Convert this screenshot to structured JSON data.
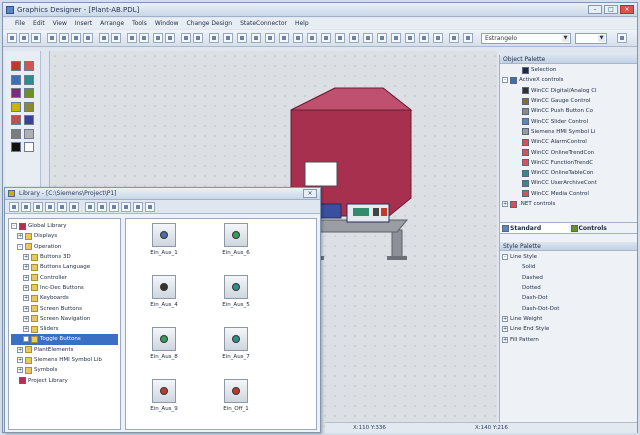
{
  "window": {
    "title": "Graphics Designer - [Plant-AB.PDL]"
  },
  "menu": [
    "File",
    "Edit",
    "View",
    "Insert",
    "Arrange",
    "Tools",
    "Window",
    "Change Design",
    "StateConnector",
    "Help"
  ],
  "toolbar": {
    "font_combo": "Estrangelo",
    "size_combo": ""
  },
  "palette": {
    "colors": [
      "#c0392b",
      "#d35454",
      "#3b6fb6",
      "#2f8d8d",
      "#7a2d7a",
      "#6b8f2a",
      "#c9b400",
      "#8a8a2d",
      "#c05050",
      "#3a3f9a",
      "#7b7b7b",
      "#b0b0b0",
      "#111111",
      "#ffffff"
    ]
  },
  "object_palette": {
    "header": "Object Palette",
    "items": [
      {
        "label": "Selection",
        "indent": 2,
        "expander": "",
        "icon": "pointer-icon",
        "color": "#1d2a40"
      },
      {
        "label": "ActiveX controls",
        "indent": 0,
        "expander": "-",
        "icon": "activex-icon",
        "color": "#3b6fb6"
      },
      {
        "label": "WinCC Digital/Analog Cl",
        "indent": 2,
        "expander": "",
        "icon": "clock-icon",
        "color": "#333333"
      },
      {
        "label": "WinCC Gauge Control",
        "indent": 2,
        "expander": "",
        "icon": "gauge-icon",
        "color": "#8a6d2d"
      },
      {
        "label": "WinCC Push Button Co",
        "indent": 2,
        "expander": "",
        "icon": "button-icon",
        "color": "#8a8a8a"
      },
      {
        "label": "WinCC Slider Control",
        "indent": 2,
        "expander": "",
        "icon": "slider-icon",
        "color": "#5a86c4"
      },
      {
        "label": "Siemens HMI Symbol Li",
        "indent": 2,
        "expander": "",
        "icon": "symbol-icon",
        "color": "#9a9a9a"
      },
      {
        "label": "WinCC AlarmControl",
        "indent": 2,
        "expander": "",
        "icon": "alarm-icon",
        "color": "#d35454"
      },
      {
        "label": "WinCC OnlineTrendCon",
        "indent": 2,
        "expander": "",
        "icon": "trend-icon",
        "color": "#d35454"
      },
      {
        "label": "WinCC FunctionTrendC",
        "indent": 2,
        "expander": "",
        "icon": "function-trend-icon",
        "color": "#d35454"
      },
      {
        "label": "WinCC OnlineTableCon",
        "indent": 2,
        "expander": "",
        "icon": "table-icon",
        "color": "#2f8d8d"
      },
      {
        "label": "WinCC UserArchiveCont",
        "indent": 2,
        "expander": "",
        "icon": "archive-icon",
        "color": "#2f8d8d"
      },
      {
        "label": "WinCC Media Control",
        "indent": 2,
        "expander": "",
        "icon": "media-icon",
        "color": "#d35454"
      },
      {
        "label": ".NET controls",
        "indent": 0,
        "expander": "+",
        "icon": "dotnet-icon",
        "color": "#d35454"
      }
    ],
    "tabs": [
      "Standard",
      "Controls"
    ]
  },
  "style_palette": {
    "header": "Style Palette",
    "items": [
      {
        "label": "Line Style",
        "indent": 0,
        "expander": "-"
      },
      {
        "label": "Solid",
        "indent": 2,
        "expander": ""
      },
      {
        "label": "Dashed",
        "indent": 2,
        "expander": ""
      },
      {
        "label": "Dotted",
        "indent": 2,
        "expander": ""
      },
      {
        "label": "Dash-Dot",
        "indent": 2,
        "expander": ""
      },
      {
        "label": "Dash-Dot-Dot",
        "indent": 2,
        "expander": ""
      },
      {
        "label": "Line Weight",
        "indent": 0,
        "expander": "+"
      },
      {
        "label": "Line End Style",
        "indent": 0,
        "expander": "+"
      },
      {
        "label": "Fill Pattern",
        "indent": 0,
        "expander": "+"
      }
    ]
  },
  "library": {
    "title": "Library - [C:\\Siemens\\Project\\P1]",
    "tree": [
      {
        "label": "Global Library",
        "indent": 0,
        "expander": "-",
        "icon": "globe-icon"
      },
      {
        "label": "Displays",
        "indent": 1,
        "expander": "+",
        "icon": "folder-icon"
      },
      {
        "label": "Operation",
        "indent": 1,
        "expander": "-",
        "icon": "folder-icon"
      },
      {
        "label": "Buttons 3D",
        "indent": 2,
        "expander": "+",
        "icon": "folder-icon"
      },
      {
        "label": "Buttons Language",
        "indent": 2,
        "expander": "+",
        "icon": "folder-icon"
      },
      {
        "label": "Controller",
        "indent": 2,
        "expander": "+",
        "icon": "folder-icon"
      },
      {
        "label": "Inc-Dec Buttons",
        "indent": 2,
        "expander": "+",
        "icon": "folder-icon"
      },
      {
        "label": "Keyboards",
        "indent": 2,
        "expander": "+",
        "icon": "folder-icon"
      },
      {
        "label": "Screen Buttons",
        "indent": 2,
        "expander": "+",
        "icon": "folder-icon"
      },
      {
        "label": "Screen Navigation",
        "indent": 2,
        "expander": "+",
        "icon": "folder-icon"
      },
      {
        "label": "Sliders",
        "indent": 2,
        "expander": "+",
        "icon": "folder-icon"
      },
      {
        "label": "Toggle Buttons",
        "indent": 2,
        "expander": "+",
        "icon": "folder-icon",
        "selected": true
      },
      {
        "label": "PlantElements",
        "indent": 1,
        "expander": "+",
        "icon": "folder-icon"
      },
      {
        "label": "Siemens HMI Symbol Lib",
        "indent": 1,
        "expander": "+",
        "icon": "folder-icon"
      },
      {
        "label": "Symbols",
        "indent": 1,
        "expander": "+",
        "icon": "folder-icon"
      },
      {
        "label": "Project Library",
        "indent": 0,
        "expander": "",
        "icon": "globe-icon"
      }
    ],
    "items": [
      {
        "label": "Ein_Aus_1",
        "icon": "switch-icon",
        "accent": "#4a6fa5"
      },
      {
        "label": "Ein_Aus_6",
        "icon": "switch-icon",
        "accent": "#3a9a5a"
      },
      {
        "label": "Ein_Aus_4",
        "icon": "switch-icon",
        "accent": "#333333"
      },
      {
        "label": "Ein_Aus_5",
        "icon": "switch-icon",
        "accent": "#2f8d8d"
      },
      {
        "label": "Ein_Aus_8",
        "icon": "switch-icon",
        "accent": "#3a9a5a"
      },
      {
        "label": "Ein_Aus_7",
        "icon": "switch-icon",
        "accent": "#2f8d8d"
      },
      {
        "label": "Ein_Aus_9",
        "icon": "switch-icon",
        "accent": "#c0392b"
      },
      {
        "label": "Ein_Off_1",
        "icon": "switch-icon",
        "accent": "#c0392b"
      }
    ]
  },
  "statusbar": {
    "coords": "X:110 Y:336",
    "size": "X:140 Y:216"
  }
}
